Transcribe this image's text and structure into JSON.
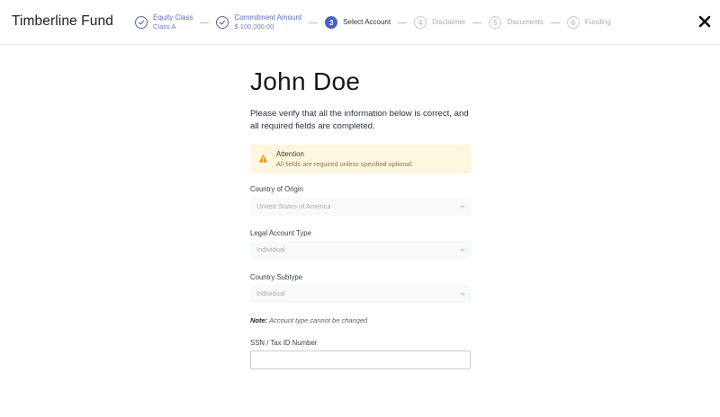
{
  "header": {
    "brand": "Timberline Fund",
    "steps": [
      {
        "number": "1",
        "label": "Equity Class",
        "sub": "Class A",
        "state": "done"
      },
      {
        "number": "2",
        "label": "Commitment Amount",
        "sub": "$ 100,000.00",
        "state": "done"
      },
      {
        "number": "3",
        "label": "Select Account",
        "sub": "",
        "state": "current"
      },
      {
        "number": "4",
        "label": "Disclaimer",
        "sub": "",
        "state": "future"
      },
      {
        "number": "5",
        "label": "Documents",
        "sub": "",
        "state": "future"
      },
      {
        "number": "6",
        "label": "Funding",
        "sub": "",
        "state": "future"
      }
    ],
    "close_icon": "close-icon"
  },
  "main": {
    "title": "John Doe",
    "description": "Please verify that all the information below is correct, and all required fields are completed.",
    "alert": {
      "icon": "warning-icon",
      "title": "Attention",
      "text": "All fields are required unless specified optional.",
      "background": "#fff6df",
      "icon_color": "#e0a21b"
    },
    "fields": {
      "country_of_origin": {
        "label": "Country of Origin",
        "value": "United States of America"
      },
      "legal_account_type": {
        "label": "Legal Account Type",
        "value": "Individual"
      },
      "country_subtype": {
        "label": "Country Subtype",
        "value": "Individual"
      }
    },
    "note": {
      "prefix": "Note:",
      "text": " Account type cannot be changed"
    },
    "ssn": {
      "label": "SSN / Tax ID Number",
      "value": "",
      "placeholder": ""
    }
  },
  "colors": {
    "accent": "#4a5fc9",
    "done_text": "#5a6eb8",
    "future_text": "#a7abb4"
  }
}
